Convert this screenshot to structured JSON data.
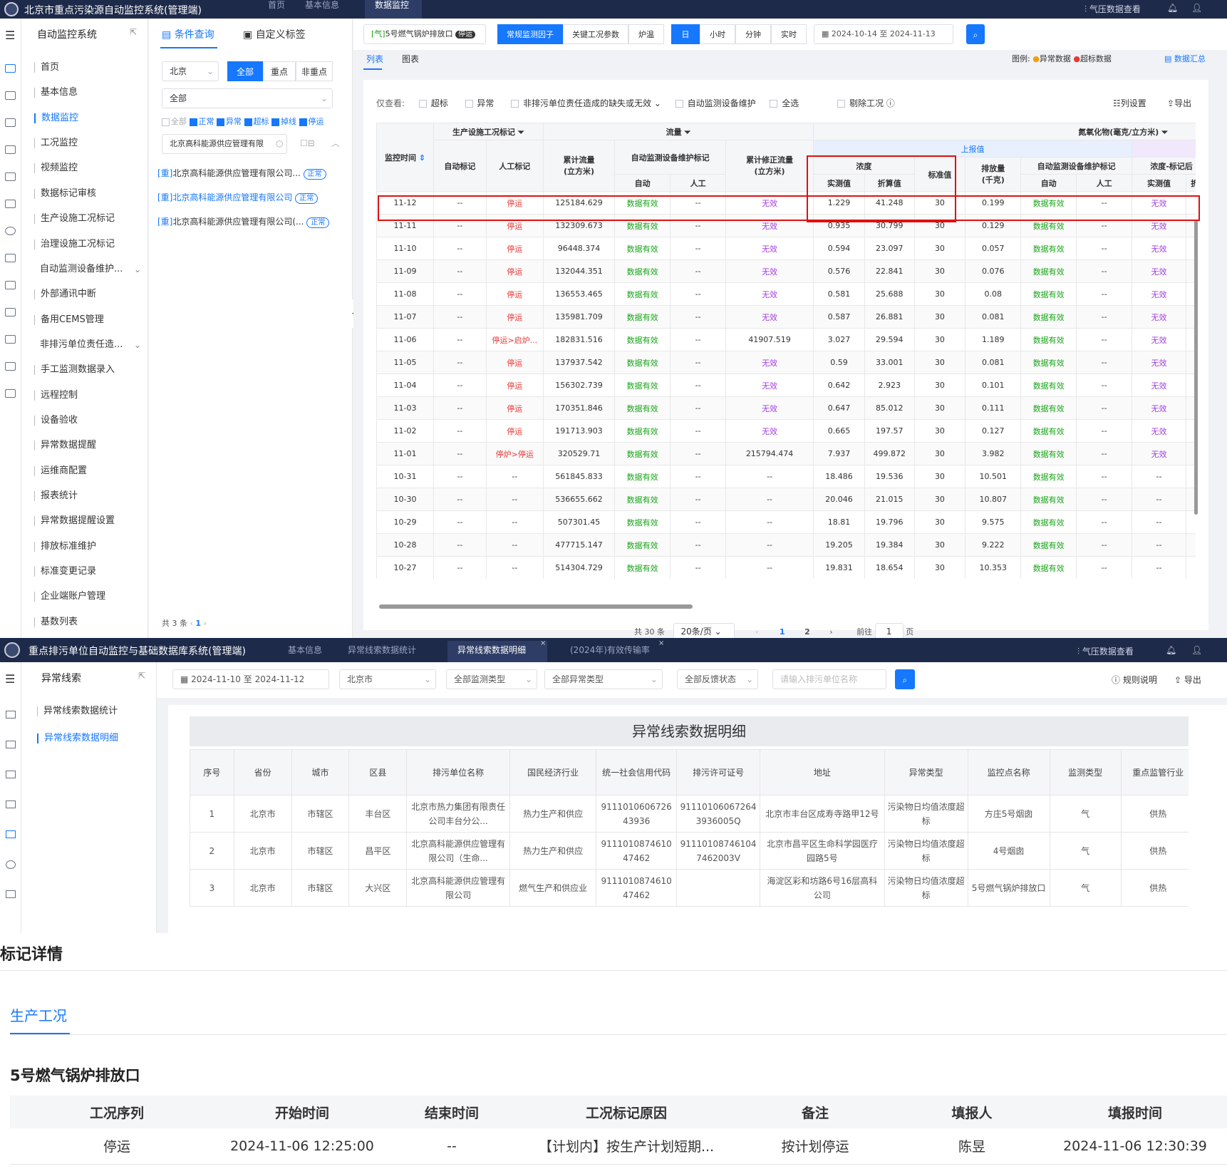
{
  "panel1": {
    "app_title": "北京市重点污染源自动监控系统(管理端)",
    "top_tabs": [
      "首页",
      "基本信息",
      "数据监控"
    ],
    "active_tab": "数据监控",
    "top_right": "气压数据查看",
    "sidebar": {
      "title": "自动监控系统",
      "items": [
        "首页",
        "基本信息",
        "数据监控",
        "工况监控",
        "视频监控",
        "数据标记审核",
        "生产设施工况标记",
        "治理设施工况标记",
        "自动监测设备维护...",
        "外部通讯中断",
        "备用CEMS管理",
        "非排污单位责任造...",
        "手工监测数据录入",
        "远程控制",
        "设备验收",
        "异常数据提醒",
        "运维商配置",
        "报表统计",
        "异常数据提醒设置",
        "排放标准维护",
        "标准变更记录",
        "企业端账户管理",
        "基数列表"
      ],
      "active": "数据监控"
    },
    "cond": {
      "tab1": "条件查询",
      "tab2": "自定义标签",
      "region": "北京",
      "filter_all": "全部",
      "filter_key": "重点",
      "filter_nonkey": "非重点",
      "select_all": "全部",
      "checks": [
        "全部",
        "正常",
        "异常",
        "超标",
        "掉线",
        "停运"
      ],
      "search_value": "北京高科能源供应管理有限",
      "companies": [
        {
          "prefix": "[重]",
          "name": "北京高科能源供应管理有限公司...",
          "status": "正常"
        },
        {
          "prefix": "[重]",
          "name": "北京高科能源供应管理有限公司",
          "status": "正常"
        },
        {
          "prefix": "[重]",
          "name": "北京高科能源供应管理有限公司(...",
          "status": "正常"
        }
      ],
      "total": "共 3 条",
      "page": "1"
    },
    "toolbar": {
      "outlet_prefix": "[气]",
      "outlet": "5号燃气锅炉排放口",
      "outlet_status": "停运",
      "factor_tabs": [
        "常规监测因子",
        "关键工况参数",
        "炉温"
      ],
      "period_tabs": [
        "日",
        "小时",
        "分钟",
        "实时"
      ],
      "date_from": "2024-10-14",
      "date_sep": "至",
      "date_to": "2024-11-13"
    },
    "view_tabs": [
      "列表",
      "图表"
    ],
    "legend_label": "图例:",
    "legend_items": [
      "异常数据",
      "超标数据"
    ],
    "data_summary": "数据汇总",
    "filter_row": {
      "label": "仅查看:",
      "options": [
        "超标",
        "异常",
        "非排污单位责任造成的缺失或无效",
        "自动监测设备维护",
        "全选"
      ],
      "exclude": "剔除工况",
      "col_settings": "列设置",
      "export": "导出"
    },
    "headers": {
      "time": "监控时间",
      "prod_mark": "生产设施工况标记",
      "auto_mark": "自动标记",
      "manual_mark": "人工标记",
      "flow": "流量",
      "cum_flow": "累计流量\n(立方米)",
      "maint": "自动监测设备维护标记",
      "auto": "自动",
      "manual": "人工",
      "cum_fix": "累计修正流量\n(立方米)",
      "nox": "氮氧化物(毫克/立方米)",
      "reported": "上报值",
      "conc": "浓度",
      "measured": "实测值",
      "converted": "折算值",
      "standard": "标准值",
      "emission": "排放量\n(千克)",
      "maint2": "自动监测设备维护标记",
      "conc_after": "浓度-标记后",
      "measured2": "实测值",
      "converted2": "折算"
    },
    "rows": [
      [
        "11-12",
        "--",
        "停运",
        "125184.629",
        "数据有效",
        "--",
        "无效",
        "1.229",
        "41.248",
        "30",
        "0.199",
        "数据有效",
        "--",
        "无效"
      ],
      [
        "11-11",
        "--",
        "停运",
        "132309.673",
        "数据有效",
        "--",
        "无效",
        "0.935",
        "30.799",
        "30",
        "0.129",
        "数据有效",
        "--",
        "无效"
      ],
      [
        "11-10",
        "--",
        "停运",
        "96448.374",
        "数据有效",
        "--",
        "无效",
        "0.594",
        "23.097",
        "30",
        "0.057",
        "数据有效",
        "--",
        "无效"
      ],
      [
        "11-09",
        "--",
        "停运",
        "132044.351",
        "数据有效",
        "--",
        "无效",
        "0.576",
        "22.841",
        "30",
        "0.076",
        "数据有效",
        "--",
        "无效"
      ],
      [
        "11-08",
        "--",
        "停运",
        "136553.465",
        "数据有效",
        "--",
        "无效",
        "0.581",
        "25.688",
        "30",
        "0.08",
        "数据有效",
        "--",
        "无效"
      ],
      [
        "11-07",
        "--",
        "停运",
        "135981.709",
        "数据有效",
        "--",
        "无效",
        "0.587",
        "26.881",
        "30",
        "0.081",
        "数据有效",
        "--",
        "无效"
      ],
      [
        "11-06",
        "--",
        "停运>启炉...",
        "182831.516",
        "数据有效",
        "--",
        "41907.519",
        "3.027",
        "29.594",
        "30",
        "1.189",
        "数据有效",
        "--",
        "无效"
      ],
      [
        "11-05",
        "--",
        "停运",
        "137937.542",
        "数据有效",
        "--",
        "无效",
        "0.59",
        "33.001",
        "30",
        "0.081",
        "数据有效",
        "--",
        "无效"
      ],
      [
        "11-04",
        "--",
        "停运",
        "156302.739",
        "数据有效",
        "--",
        "无效",
        "0.642",
        "2.923",
        "30",
        "0.101",
        "数据有效",
        "--",
        "无效"
      ],
      [
        "11-03",
        "--",
        "停运",
        "170351.846",
        "数据有效",
        "--",
        "无效",
        "0.647",
        "85.012",
        "30",
        "0.111",
        "数据有效",
        "--",
        "无效"
      ],
      [
        "11-02",
        "--",
        "停运",
        "191713.903",
        "数据有效",
        "--",
        "无效",
        "0.665",
        "197.57",
        "30",
        "0.127",
        "数据有效",
        "--",
        "无效"
      ],
      [
        "11-01",
        "--",
        "停炉>停运",
        "320529.71",
        "数据有效",
        "--",
        "215794.474",
        "7.937",
        "499.872",
        "30",
        "3.982",
        "数据有效",
        "--",
        "无效"
      ],
      [
        "10-31",
        "--",
        "--",
        "561845.833",
        "数据有效",
        "--",
        "--",
        "18.486",
        "19.536",
        "30",
        "10.501",
        "数据有效",
        "--",
        "--"
      ],
      [
        "10-30",
        "--",
        "--",
        "536655.662",
        "数据有效",
        "--",
        "--",
        "20.046",
        "21.015",
        "30",
        "10.807",
        "数据有效",
        "--",
        "--"
      ],
      [
        "10-29",
        "--",
        "--",
        "507301.45",
        "数据有效",
        "--",
        "--",
        "18.81",
        "19.796",
        "30",
        "9.575",
        "数据有效",
        "--",
        "--"
      ],
      [
        "10-28",
        "--",
        "--",
        "477715.147",
        "数据有效",
        "--",
        "--",
        "19.205",
        "19.384",
        "30",
        "9.222",
        "数据有效",
        "--",
        "--"
      ],
      [
        "10-27",
        "--",
        "--",
        "514304.729",
        "数据有效",
        "--",
        "--",
        "19.831",
        "18.654",
        "30",
        "10.353",
        "数据有效",
        "--",
        "--"
      ]
    ],
    "pager": {
      "total": "共 30 条",
      "size": "20条/页",
      "pages": [
        "1",
        "2"
      ],
      "goto": "前往",
      "goto_val": "1",
      "page_unit": "页"
    }
  },
  "panel2": {
    "app_title": "重点排污单位自动监控与基础数据库系统(管理端)",
    "tabs": [
      "基本信息",
      "异常线索数据统计",
      "异常线索数据明细",
      "(2024年)有效传输率"
    ],
    "active_tab": "异常线索数据明细",
    "top_right": "气压数据查看",
    "sidebar_title": "异常线索",
    "sidebar_items": [
      "异常线索数据统计",
      "异常线索数据明细"
    ],
    "filters": {
      "date_from": "2024-11-10",
      "date_sep": "至",
      "date_to": "2024-11-12",
      "city": "北京市",
      "monitor_type": "全部监测类型",
      "anomaly_type": "全部异常类型",
      "feedback": "全部反馈状态",
      "company_placeholder": "请输入排污单位名称",
      "rules": "规则说明",
      "export": "导出"
    },
    "table_title": "异常线索数据明细",
    "columns": [
      "序号",
      "省份",
      "城市",
      "区县",
      "排污单位名称",
      "国民经济行业",
      "统一社会信用代码",
      "排污许可证号",
      "地址",
      "异常类型",
      "监控点名称",
      "监测类型",
      "重点监管行业"
    ],
    "rows": [
      [
        "1",
        "北京市",
        "市辖区",
        "丰台区",
        "北京市热力集团有限责任公司丰台分公...",
        "热力生产和供应",
        "911101060672643936",
        "911101060672643936005Q",
        "北京市丰台区成寿寺路甲12号",
        "污染物日均值浓度超标",
        "方庄5号烟囱",
        "气",
        "供热"
      ],
      [
        "2",
        "北京市",
        "市辖区",
        "昌平区",
        "北京高科能源供应管理有限公司（生命...",
        "热力生产和供应",
        "911101087461047462",
        "911101087461047462003V",
        "北京市昌平区生命科学园医疗园路5号",
        "污染物日均值浓度超标",
        "4号烟囱",
        "气",
        "供热"
      ],
      [
        "3",
        "北京市",
        "市辖区",
        "大兴区",
        "北京高科能源供应管理有限公司",
        "燃气生产和供应业",
        "911101087461047462",
        "",
        "海淀区彩和坊路6号16层高科公司",
        "污染物日均值浓度超标",
        "5号燃气锅炉排放口",
        "气",
        "供热"
      ]
    ]
  },
  "panel3": {
    "title": "标记详情",
    "tab": "生产工况",
    "outlet": "5号燃气锅炉排放口",
    "columns": [
      "工况序列",
      "开始时间",
      "结束时间",
      "工况标记原因",
      "备注",
      "填报人",
      "填报时间"
    ],
    "row": [
      "停运",
      "2024-11-06 12:25:00",
      "--",
      "【计划内】按生产计划短期...",
      "按计划停运",
      "陈昱",
      "2024-11-06 12:30:39"
    ]
  },
  "colors": {
    "accent": "#1677ff",
    "valid": "#18a518",
    "stopped": "#e53935",
    "invalid": "#a33be0",
    "highlight": "#e01010",
    "navbar": "#1e2a4a"
  }
}
